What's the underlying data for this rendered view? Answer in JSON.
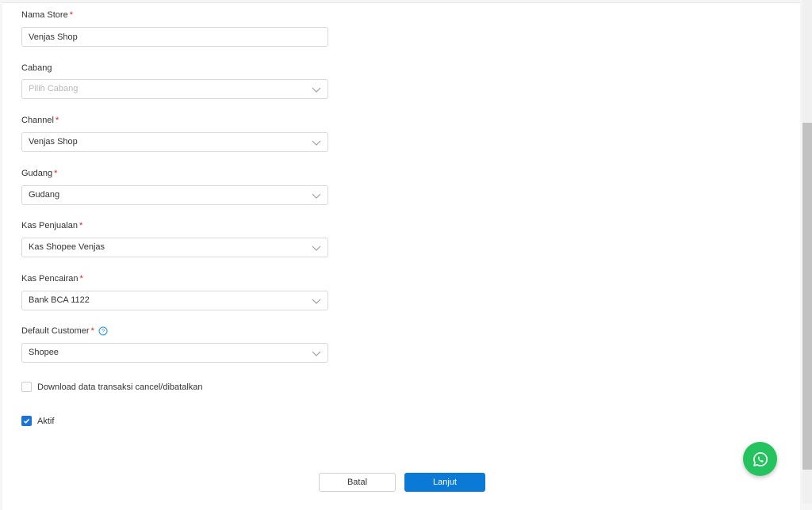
{
  "form": {
    "store_name": {
      "label": "Nama Store",
      "required_mark": "*",
      "value": "Venjas Shop"
    },
    "branch": {
      "label": "Cabang",
      "placeholder": "Pilih Cabang"
    },
    "channel": {
      "label": "Channel",
      "required_mark": "*",
      "value": "Venjas Shop"
    },
    "warehouse": {
      "label": "Gudang",
      "required_mark": "*",
      "value": "Gudang"
    },
    "sales_cash": {
      "label": "Kas Penjualan",
      "required_mark": "*",
      "value": "Kas Shopee Venjas"
    },
    "disbursement_cash": {
      "label": "Kas Pencairan",
      "required_mark": "*",
      "value": "Bank BCA 1122"
    },
    "default_customer": {
      "label": "Default Customer",
      "required_mark": "*",
      "value": "Shopee"
    },
    "download_cancel": {
      "label": "Download data transaksi cancel/dibatalkan",
      "checked": false
    },
    "active": {
      "label": "Aktif",
      "checked": true
    }
  },
  "actions": {
    "cancel_label": "Batal",
    "next_label": "Lanjut"
  },
  "icons": {
    "chevron": "chevron-down-icon",
    "help": "question-circle-icon",
    "whatsapp": "whatsapp-icon",
    "check": "checkmark-icon"
  },
  "colors": {
    "primary": "#0b7ad6",
    "required": "#e02020",
    "whatsapp": "#25c360",
    "checkbox_checked": "#1a73d9"
  }
}
